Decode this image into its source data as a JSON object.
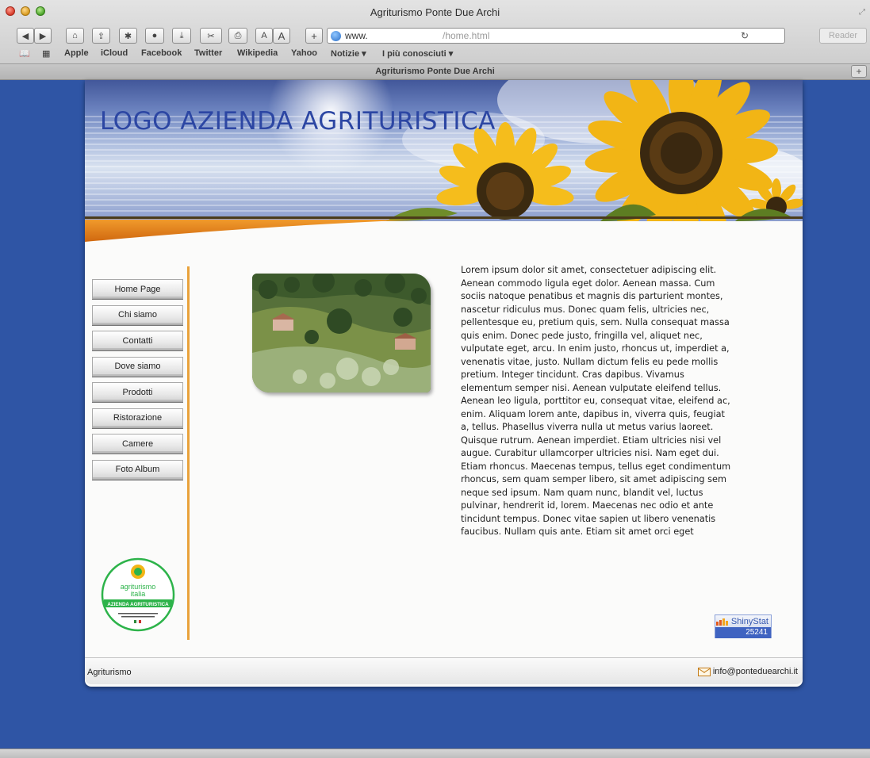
{
  "window": {
    "title": "Agriturismo Ponte Due Archi"
  },
  "toolbar": {
    "address_www": "www.",
    "address_path": "/home.html",
    "reload_icon": "reload-icon",
    "reader_label": "Reader",
    "font_small": "A",
    "font_large": "A",
    "add_label": "+"
  },
  "bookmarks": {
    "items": [
      "Apple",
      "iCloud",
      "Facebook",
      "Twitter",
      "Wikipedia",
      "Yahoo",
      "Notizie ▾",
      "I più conosciuti ▾"
    ]
  },
  "tab": {
    "title": "Agriturismo Ponte Due Archi",
    "new_tab": "+"
  },
  "header": {
    "logo_text": "LOGO AZIENDA AGRITURISTICA"
  },
  "nav": {
    "items": [
      "Home Page",
      "Chi siamo",
      "Contatti",
      "Dove siamo",
      "Prodotti",
      "Ristorazione",
      "Camere",
      "Foto Album"
    ]
  },
  "badge": {
    "line1": "agriturismo",
    "line2": "italia",
    "band": "AZIENDA AGRITURISTICA"
  },
  "content": {
    "body": "Lorem ipsum dolor sit amet, consectetuer adipiscing elit. Aenean commodo ligula eget dolor. Aenean massa. Cum sociis natoque penatibus et magnis dis parturient montes, nascetur ridiculus mus. Donec quam felis, ultricies nec, pellentesque eu, pretium quis, sem. Nulla consequat massa quis enim. Donec pede justo, fringilla vel, aliquet nec, vulputate eget, arcu. In enim justo, rhoncus ut, imperdiet a, venenatis vitae, justo. Nullam dictum felis eu pede mollis pretium. Integer tincidunt. Cras dapibus. Vivamus elementum semper nisi. Aenean vulputate eleifend tellus. Aenean leo ligula, porttitor eu, consequat vitae, eleifend ac, enim. Aliquam lorem ante, dapibus in, viverra quis, feugiat a, tellus. Phasellus viverra nulla ut metus varius laoreet. Quisque rutrum. Aenean imperdiet. Etiam ultricies nisi vel augue. Curabitur ullamcorper ultricies nisi. Nam eget dui. Etiam rhoncus. Maecenas tempus, tellus eget condimentum rhoncus, sem quam semper libero, sit amet adipiscing sem neque sed ipsum. Nam quam nunc, blandit vel, luctus pulvinar, hendrerit id, lorem. Maecenas nec odio et ante tincidunt tempus. Donec vitae sapien ut libero venenatis faucibus. Nullam quis ante. Etiam sit amet orci eget"
  },
  "counter": {
    "brand": "ShinyStat",
    "value": "25241"
  },
  "footer": {
    "left": "Agriturismo",
    "email": "info@ponteduearchi.it"
  },
  "colors": {
    "page_bg": "#2f55a5",
    "logo": "#2c46a3",
    "accent_orange": "#e9a23b",
    "badge_green": "#2db34a"
  }
}
